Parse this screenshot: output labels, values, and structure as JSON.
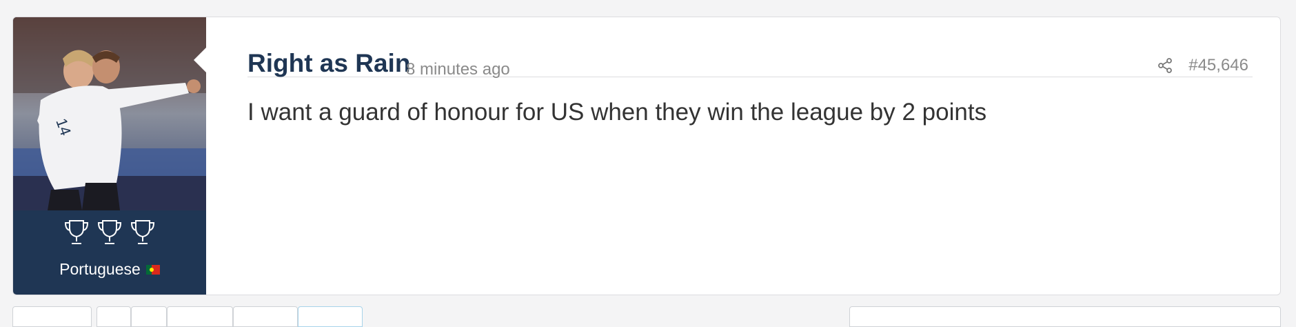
{
  "post": {
    "username": "Right as Rain",
    "timestamp": "8 minutes ago",
    "post_number": "#45,646",
    "content": "I want a guard of honour for US when they win the league by 2 points"
  },
  "user_panel": {
    "badge_label": "Portuguese",
    "trophy_count": 3
  },
  "icons": {
    "share": "share-icon",
    "trophy": "trophy-icon",
    "flag": "portugal-flag-icon"
  },
  "colors": {
    "panel_bg": "#1f3654",
    "username": "#1f3654",
    "meta_text": "#8a8a8a",
    "content_text": "#333333"
  }
}
